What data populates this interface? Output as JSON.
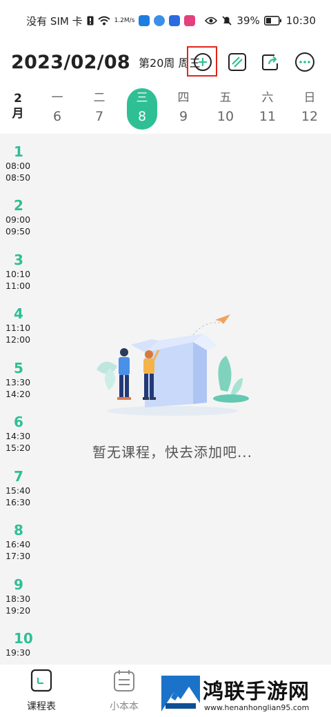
{
  "status_bar": {
    "carrier": "没有 SIM 卡",
    "speed_value": "1.2",
    "speed_unit": "M/s",
    "battery": "39%",
    "time": "10:30"
  },
  "header": {
    "date": "2023/02/08",
    "week_info": "第20周 周三"
  },
  "week": {
    "month_label": "2",
    "month_suffix": "月",
    "days": [
      {
        "name": "一",
        "num": "6"
      },
      {
        "name": "二",
        "num": "7"
      },
      {
        "name": "三",
        "num": "8"
      },
      {
        "name": "四",
        "num": "9"
      },
      {
        "name": "五",
        "num": "10"
      },
      {
        "name": "六",
        "num": "11"
      },
      {
        "name": "日",
        "num": "12"
      }
    ],
    "active_index": 2
  },
  "timeline": [
    {
      "num": "1",
      "start": "08:00",
      "end": "08:50"
    },
    {
      "num": "2",
      "start": "09:00",
      "end": "09:50"
    },
    {
      "num": "3",
      "start": "10:10",
      "end": "11:00"
    },
    {
      "num": "4",
      "start": "11:10",
      "end": "12:00"
    },
    {
      "num": "5",
      "start": "13:30",
      "end": "14:20"
    },
    {
      "num": "6",
      "start": "14:30",
      "end": "15:20"
    },
    {
      "num": "7",
      "start": "15:40",
      "end": "16:30"
    },
    {
      "num": "8",
      "start": "16:40",
      "end": "17:30"
    },
    {
      "num": "9",
      "start": "18:30",
      "end": "19:20"
    },
    {
      "num": "10",
      "start": "19:30",
      "end": ""
    }
  ],
  "empty_state": {
    "message": "暂无课程，快去添加吧..."
  },
  "bottom_nav": {
    "items": [
      {
        "label": "课程表",
        "icon": "schedule-icon"
      },
      {
        "label": "小本本",
        "icon": "notebook-icon"
      }
    ]
  },
  "watermark": {
    "title": "鸿联手游网",
    "url": "www.henanhonglian95.com"
  },
  "colors": {
    "accent": "#2fbf94",
    "highlight_box": "#e0241b",
    "content_bg": "#f4f4f4"
  }
}
